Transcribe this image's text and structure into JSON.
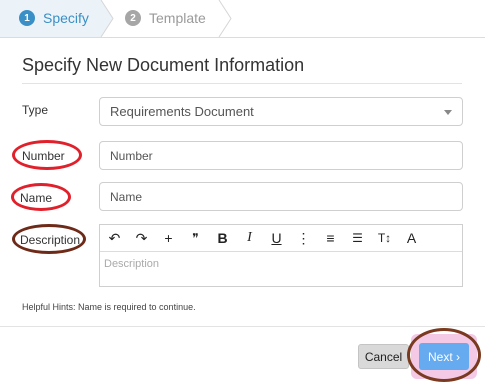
{
  "wizard": {
    "steps": [
      {
        "number": "1",
        "label": "Specify"
      },
      {
        "number": "2",
        "label": "Template"
      }
    ]
  },
  "dialog": {
    "title": "Specify New Document Information",
    "hint": "Helpful Hints: Name is required to continue."
  },
  "form": {
    "type_label": "Type",
    "type_value": "Requirements Document",
    "number_label": "Number",
    "number_placeholder": "Number",
    "name_label": "Name",
    "name_placeholder": "Name",
    "description_label": "Description",
    "description_placeholder": "Description"
  },
  "toolbar": {
    "undo": "↶",
    "redo": "↷",
    "insert": "+",
    "comment": "❞",
    "bold": "B",
    "italic": "I",
    "underline": "U",
    "more": "⋮",
    "align": "≡",
    "list": "☰",
    "text_size": "T↕",
    "font_color": "A"
  },
  "buttons": {
    "cancel": "Cancel",
    "next": "Next ›"
  },
  "colors": {
    "accent": "#3a8fc6",
    "annotation_red": "#e0202a",
    "annotation_brown": "#7a3a20",
    "next_button": "#66aaf0"
  }
}
